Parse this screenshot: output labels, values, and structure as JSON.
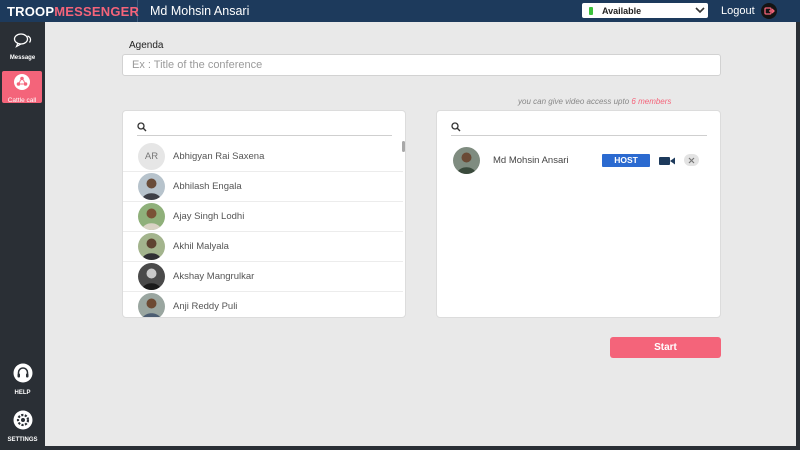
{
  "header": {
    "brand_part1": "TROOP",
    "brand_part2": "MESSENGER",
    "user_name": "Md Mohsin Ansari",
    "status": "Available",
    "logout_label": "Logout"
  },
  "sidebar": {
    "message_label": "Message",
    "cattle_call_label": "Cattle call",
    "help_label": "HELP",
    "settings_label": "SETTINGS"
  },
  "agenda": {
    "label": "Agenda",
    "placeholder": "Ex : Title of the conference",
    "value": ""
  },
  "video_note": {
    "text": "you can give video access upto ",
    "highlight": "6 members"
  },
  "contacts": [
    {
      "name": "Abhigyan Rai Saxena",
      "initials": "AR"
    },
    {
      "name": "Abhilash Engala"
    },
    {
      "name": "Ajay Singh Lodhi"
    },
    {
      "name": "Akhil Malyala"
    },
    {
      "name": "Akshay Mangrulkar"
    },
    {
      "name": "Anji Reddy Puli"
    }
  ],
  "selected": [
    {
      "name": "Md Mohsin Ansari",
      "role": "HOST"
    }
  ],
  "start_label": "Start",
  "colors": {
    "accent": "#f4647a",
    "header": "#1d3a5c",
    "sidebar": "#2a2f35",
    "host": "#2b6ad0"
  }
}
